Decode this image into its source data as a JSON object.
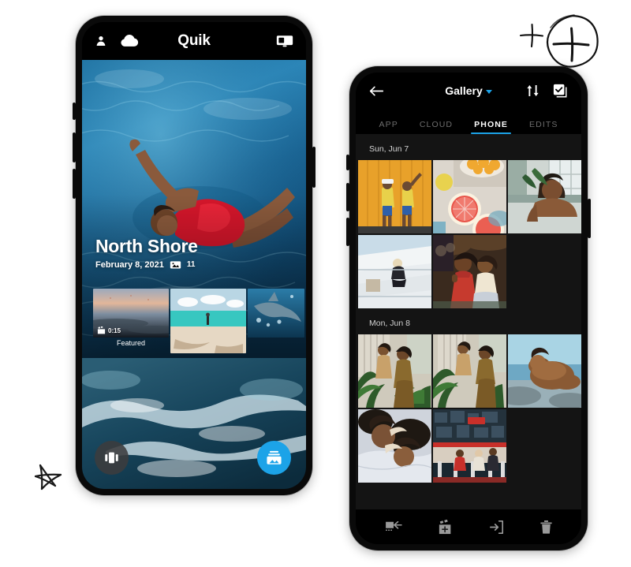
{
  "left_phone": {
    "name": "quik-app-phone",
    "topbar": {
      "title": "Quik",
      "icons": [
        "person-icon",
        "cloud-icon",
        "gopro-camera-icon"
      ]
    },
    "hero": {
      "title": "North Shore",
      "date": "February 8, 2021",
      "photo_icon": "photo-stack-icon",
      "count": "11"
    },
    "thumbnails": [
      {
        "label": "Featured",
        "duration": "0:15",
        "has_video_icon": true
      },
      {
        "label": "",
        "duration": "",
        "has_video_icon": false
      },
      {
        "label": "",
        "duration": "",
        "has_video_icon": false
      }
    ],
    "buttons": {
      "left_fab": "create-mashup-button",
      "right_fab": "media-library-button"
    }
  },
  "right_phone": {
    "name": "gallery-picker-phone",
    "topbar": {
      "back": "back-arrow-icon",
      "title": "Gallery",
      "dropdown": "chevron-down-icon",
      "sort": "sort-icon",
      "select_all": "select-all-checkbox-icon"
    },
    "tabs": [
      {
        "label": "APP",
        "active": false
      },
      {
        "label": "CLOUD",
        "active": false
      },
      {
        "label": "PHONE",
        "active": true
      },
      {
        "label": "EDITS",
        "active": false
      }
    ],
    "sections": [
      {
        "date": "Sun, Jun 7",
        "photos": [
          "two-women-yellow-wall",
          "grapefruit-breakfast-table",
          "man-with-plant-window",
          "white-building-figure",
          "two-women-red-dress-outdoors"
        ]
      },
      {
        "date": "Mon, Jun 8",
        "photos": [
          "couple-in-garden-wide",
          "couple-in-garden-crop",
          "woman-on-rock-by-sea",
          "two-women-lying-down",
          "people-at-diner-counter"
        ]
      }
    ],
    "bottombar": [
      {
        "icon": "add-to-project-icon",
        "label": "Add to project"
      },
      {
        "icon": "add-to-video-icon",
        "label": "Add to video"
      },
      {
        "icon": "save-to-device-icon",
        "label": "Save to device"
      },
      {
        "icon": "trash-icon",
        "label": "Delete"
      }
    ]
  },
  "annotations": {
    "star": "hand-drawn-star-sketch",
    "plus_small": "hand-drawn-small-plus-sketch",
    "plus_circled": "hand-drawn-circled-plus-sketch"
  },
  "colors": {
    "accent_blue": "#1CA3E8",
    "phone_body": "#0a0a0a",
    "gallery_bg": "#141414",
    "tab_inactive": "#6e6e6e",
    "page_bg": "#ffffff"
  }
}
